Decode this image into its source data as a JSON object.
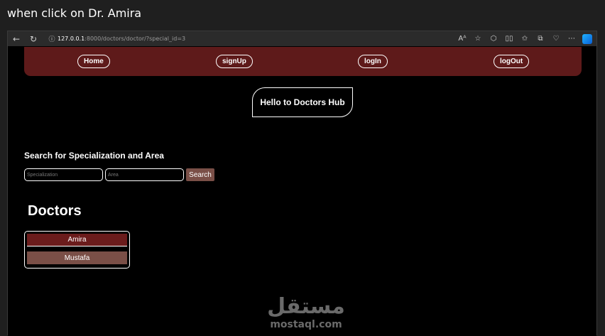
{
  "caption": "when click on Dr. Amira",
  "browser": {
    "url_host": "127.0.0.1",
    "url_rest": ":8000/doctors/doctor/?special_id=3"
  },
  "nav": {
    "home": "Home",
    "signup": "signUp",
    "login": "logIn",
    "logout": "logOut"
  },
  "hero": "Hello to Doctors Hub",
  "search": {
    "title": "Search for Specialization and Area",
    "specialization_placeholder": "Specialization",
    "area_placeholder": "Area",
    "button": "Search"
  },
  "doctors": {
    "title": "Doctors",
    "items": [
      "Amira",
      "Mustafa"
    ]
  },
  "watermark": {
    "arabic": "مستقل",
    "latin": "mostaql.com"
  }
}
